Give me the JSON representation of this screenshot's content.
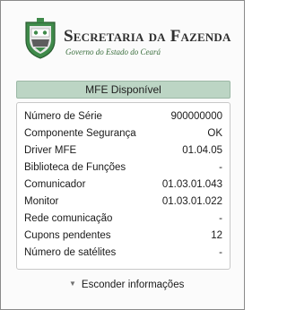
{
  "header": {
    "title": "Secretaria da Fazenda",
    "subtitle": "Governo do Estado do Ceará"
  },
  "status": {
    "label": "MFE Disponível"
  },
  "info": [
    {
      "label": "Número de Série",
      "value": "900000000"
    },
    {
      "label": "Componente Segurança",
      "value": "OK"
    },
    {
      "label": "Driver MFE",
      "value": "01.04.05"
    },
    {
      "label": "Biblioteca de Funções",
      "value": "-"
    },
    {
      "label": "Comunicador",
      "value": "01.03.01.043"
    },
    {
      "label": "Monitor",
      "value": "01.03.01.022"
    },
    {
      "label": "Rede comunicação",
      "value": "-"
    },
    {
      "label": "Cupons pendentes",
      "value": "12"
    },
    {
      "label": "Número de satélites",
      "value": "-"
    }
  ],
  "toggle": {
    "label": "Esconder informações",
    "icon": "triangle-down-icon"
  },
  "colors": {
    "status_bar": "#bcd5c4",
    "crest_green": "#3f8a4a"
  }
}
